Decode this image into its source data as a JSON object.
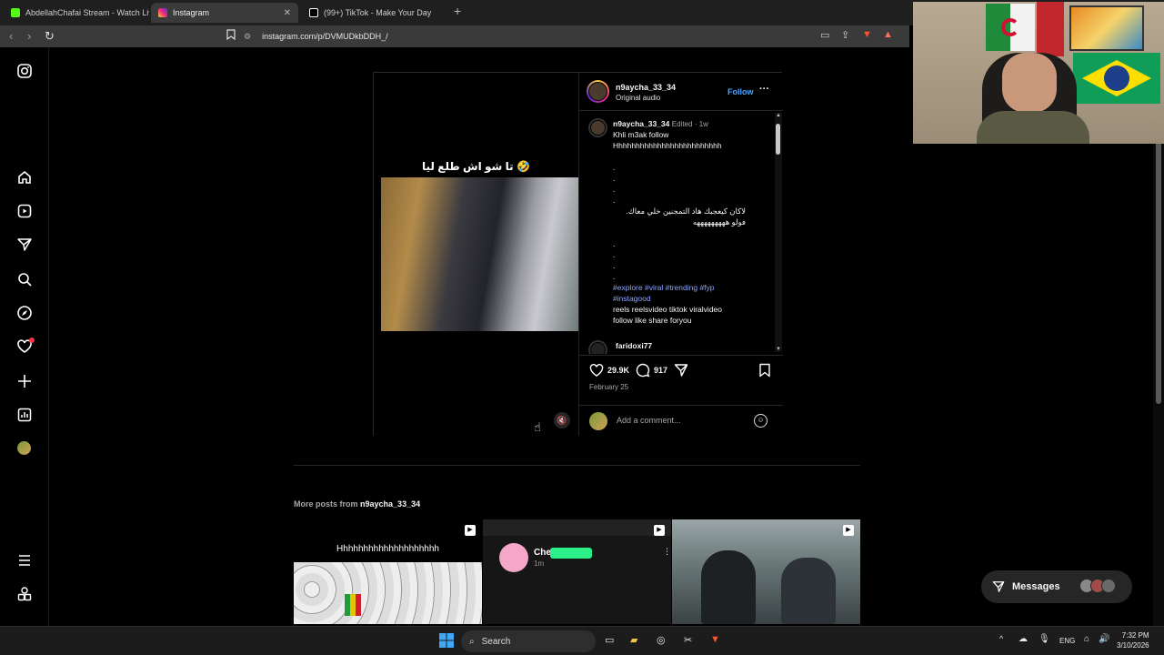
{
  "browser": {
    "tabs": [
      {
        "title": "AbdellahChafai Stream - Watch Live s",
        "color": "#53fc18",
        "active": false
      },
      {
        "title": "Instagram",
        "color": "#e1306c",
        "active": true
      },
      {
        "title": "(99+) TikTok - Make Your Day",
        "color": "#ffffff",
        "active": false
      }
    ],
    "url": "instagram.com/p/DVMUDkbDDH_/"
  },
  "sidebar": {
    "icons": [
      "instagram-logo-icon",
      "home-icon",
      "reels-icon",
      "messages-icon",
      "search-icon",
      "explore-icon",
      "notifications-icon",
      "create-icon",
      "dashboard-icon",
      "profile-avatar",
      "menu-icon",
      "threads-icon"
    ]
  },
  "post": {
    "media_caption": "تا شو اش طلع ليا 🤣",
    "author": "n9aycha_33_34",
    "audio": "Original audio",
    "follow_label": "Follow",
    "more_label": "···",
    "caption": {
      "author": "n9aycha_33_34",
      "edited": "Edited",
      "time": "1w",
      "line1": "Khli m3ak follow",
      "line2": "Hhhhhhhhhhhhhhhhhhhhhhhhh",
      "dots": ".",
      "arabic1": "لاكان كيعجبك هاد التمجنين خلي معاك.",
      "arabic2": "فولو هههههههههه",
      "hashtags1": "#explore #viral #trending #fyp",
      "hashtags2": "#instagood",
      "tags1": "reels reelsvideo tiktok viralvideo",
      "tags2": "follow like share foryou"
    },
    "next_comment_author": "faridoxi77",
    "likes": "29.9K",
    "comments": "917",
    "date": "February 25",
    "add_comment_placeholder": "Add a comment..."
  },
  "more_posts": {
    "label": "More posts from",
    "author": "n9aycha_33_34",
    "thumb1_text": "Hhhhhhhhhhhhhhhhhhhh",
    "thumb2_name": "Che",
    "thumb2_time": "1m"
  },
  "messages": {
    "label": "Messages"
  },
  "taskbar": {
    "search": "Search",
    "lang": "ENG",
    "time": "7:32 PM",
    "date": "3/10/2026"
  }
}
